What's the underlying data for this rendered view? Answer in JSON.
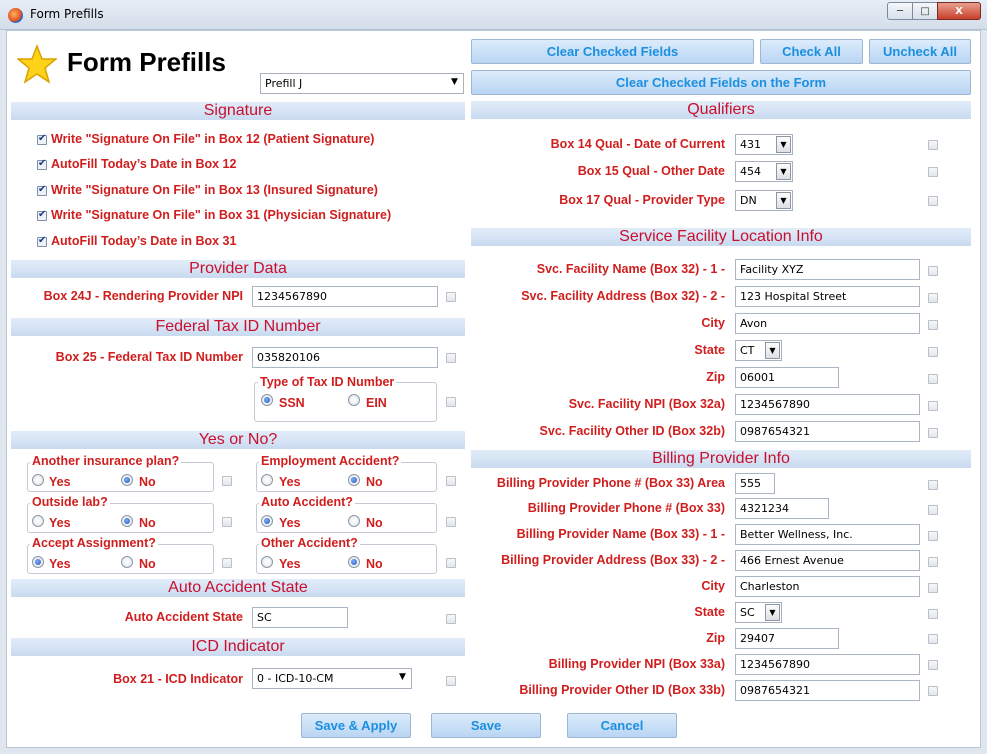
{
  "window": {
    "title": "Form Prefills",
    "close_label": "X"
  },
  "page_title": "Form Prefills",
  "prefill_select": "Prefill J",
  "top_buttons": {
    "clear_checked": "Clear Checked Fields",
    "check_all": "Check All",
    "uncheck_all": "Uncheck All",
    "clear_on_form": "Clear Checked Fields on the Form"
  },
  "signature": {
    "header": "Signature",
    "items": [
      {
        "label": "Write \"Signature On File\" in Box 12 (Patient Signature)",
        "checked": true
      },
      {
        "label": "AutoFill Today’s Date in Box 12",
        "checked": true
      },
      {
        "label": "Write \"Signature On File\" in Box 13 (Insured Signature)",
        "checked": true
      },
      {
        "label": "Write \"Signature On File\" in Box 31 (Physician Signature)",
        "checked": true
      },
      {
        "label": "AutoFill Today’s Date in Box 31",
        "checked": true
      }
    ]
  },
  "provider_data": {
    "header": "Provider Data",
    "npi_label": "Box 24J - Rendering Provider NPI",
    "npi_value": "1234567890"
  },
  "federal_tax": {
    "header": "Federal Tax ID Number",
    "label": "Box 25 - Federal Tax ID Number",
    "value": "035820106",
    "type_label": "Type of Tax ID Number",
    "ssn": "SSN",
    "ein": "EIN",
    "selected": "SSN"
  },
  "yes_no": {
    "header": "Yes or No?",
    "yes": "Yes",
    "no": "No",
    "groups": [
      {
        "label": "Another insurance plan?",
        "value": "No"
      },
      {
        "label": "Employment Accident?",
        "value": "No"
      },
      {
        "label": "Outside lab?",
        "value": "No"
      },
      {
        "label": "Auto Accident?",
        "value": "Yes"
      },
      {
        "label": "Accept Assignment?",
        "value": "Yes"
      },
      {
        "label": "Other Accident?",
        "value": "No"
      }
    ]
  },
  "auto_accident": {
    "header": "Auto Accident State",
    "label": "Auto Accident State",
    "value": "SC"
  },
  "icd": {
    "header": "ICD Indicator",
    "label": "Box 21 - ICD Indicator",
    "value": "0 - ICD-10-CM"
  },
  "qualifiers": {
    "header": "Qualifiers",
    "rows": [
      {
        "label": "Box 14 Qual - Date of Current",
        "value": "431"
      },
      {
        "label": "Box 15 Qual - Other Date",
        "value": "454"
      },
      {
        "label": "Box 17 Qual - Provider Type",
        "value": "DN"
      }
    ]
  },
  "service_facility": {
    "header": "Service Facility Location Info",
    "name_label": "Svc. Facility Name (Box 32) - 1 -",
    "name": "Facility XYZ",
    "address_label": "Svc. Facility Address (Box 32) - 2 -",
    "address": "123 Hospital Street",
    "city_label": "City",
    "city": "Avon",
    "state_label": "State",
    "state": "CT",
    "zip_label": "Zip",
    "zip": "06001",
    "npi_label": "Svc. Facility NPI (Box 32a)",
    "npi": "1234567890",
    "other_label": "Svc. Facility Other ID (Box 32b)",
    "other": "0987654321"
  },
  "billing": {
    "header": "Billing Provider Info",
    "phone_area_label": "Billing Provider Phone # (Box 33) Area",
    "phone_area": "555",
    "phone_label": "Billing Provider Phone # (Box 33)",
    "phone": "4321234",
    "name_label": "Billing Provider Name (Box 33) - 1 -",
    "name": "Better Wellness, Inc.",
    "address_label": "Billing Provider Address (Box 33) - 2 -",
    "address": "466 Ernest Avenue",
    "city_label": "City",
    "city": "Charleston",
    "state_label": "State",
    "state": "SC",
    "zip_label": "Zip",
    "zip": "29407",
    "npi_label": "Billing Provider NPI (Box 33a)",
    "npi": "1234567890",
    "other_label": "Billing Provider Other ID (Box 33b)",
    "other": "0987654321"
  },
  "bottom_buttons": {
    "save_apply": "Save & Apply",
    "save": "Save",
    "cancel": "Cancel"
  }
}
